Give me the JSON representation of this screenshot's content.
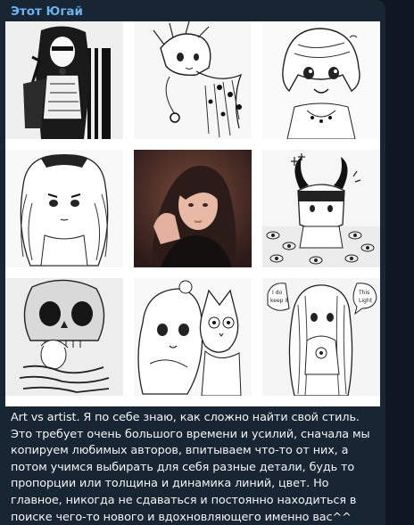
{
  "post": {
    "channel_name": "Этот Югай",
    "caption": "Art vs artist. Я по себе знаю, как сложно найти свой стиль. Это требует очень большого времени и усилий, сначала мы копируем любимых авторов, впитываем что-то от них, а потом учимся выбирать для себя разные детали, будь то пропорции или толщина и динамика линий, цвет. Но главное, никогда не сдаваться и постоянно находиться в поиске чего-то нового и вдохновляющего именно вас^^"
  },
  "gallery": {
    "tiles": [
      {
        "name": "artwork-knight-girl",
        "kind": "drawing"
      },
      {
        "name": "artwork-flower-girl",
        "kind": "drawing"
      },
      {
        "name": "artwork-smiling-girl",
        "kind": "drawing"
      },
      {
        "name": "artwork-ornate-girl",
        "kind": "drawing"
      },
      {
        "name": "artist-photo",
        "kind": "photo"
      },
      {
        "name": "artwork-horned-girl",
        "kind": "drawing"
      },
      {
        "name": "artwork-skeleton",
        "kind": "drawing"
      },
      {
        "name": "artwork-cat-and-girl",
        "kind": "drawing"
      },
      {
        "name": "artwork-long-hair-girl",
        "kind": "drawing"
      }
    ],
    "speech_bubbles": [
      "I do keep it",
      "This is Light"
    ]
  },
  "colors": {
    "background": "#0e1621",
    "bubble": "#182533",
    "channel_name": "#6ab3f3",
    "caption_text": "#f5f5f5"
  }
}
